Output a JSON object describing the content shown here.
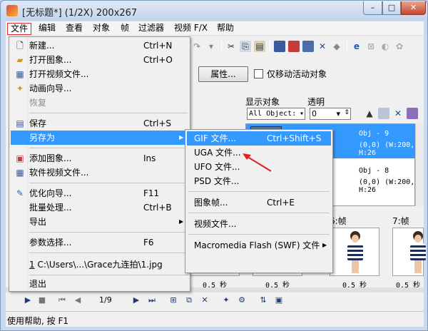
{
  "window": {
    "title": "[无标题*] (1/2X)  200x267",
    "minimize": "–",
    "maximize": "□",
    "close": "✕"
  },
  "menubar": [
    "文件",
    "编辑",
    "查看",
    "对象",
    "帧",
    "过滤器",
    "视频 F/X",
    "帮助"
  ],
  "properties": {
    "button": "属性...",
    "checkbox_label": "仅移动活动对象"
  },
  "object_panel": {
    "display_label": "显示对象",
    "opacity_label": "透明",
    "display_value": "All Object:",
    "opacity_value": "0",
    "objects": [
      {
        "name": "Obj - 9",
        "info": "(0,0) (W:200, H:26"
      },
      {
        "name": "Obj - 8",
        "info": "(0,0) (W:200, H:26"
      }
    ]
  },
  "frames": {
    "labels": [
      "6:帧",
      "7:帧"
    ],
    "times": [
      "0.5 秒",
      "0.5 秒",
      "0.5 秒",
      "0.5 秒"
    ]
  },
  "playbar": {
    "counter": "1/9"
  },
  "status": "使用帮助, 按 F1",
  "file_menu": {
    "new": {
      "label": "新建...",
      "shortcut": "Ctrl+N"
    },
    "open_image": {
      "label": "打开图象...",
      "shortcut": "Ctrl+O"
    },
    "open_video": {
      "label": "打开视频文件..."
    },
    "animation_wizard": {
      "label": "动画向导..."
    },
    "restore": {
      "label": "恢复"
    },
    "save": {
      "label": "保存",
      "shortcut": "Ctrl+S"
    },
    "save_as": {
      "label": "另存为"
    },
    "add_image": {
      "label": "添加图象...",
      "shortcut": "Ins"
    },
    "software_video": {
      "label": "软件视频文件..."
    },
    "optimize_wizard": {
      "label": "优化向导...",
      "shortcut": "F11"
    },
    "batch": {
      "label": "批量处理...",
      "shortcut": "Ctrl+B"
    },
    "export": {
      "label": "导出"
    },
    "preferences": {
      "label": "参数选择...",
      "shortcut": "F6"
    },
    "recent": {
      "number": "1",
      "label": "C:\\Users\\...\\Grace九连拍\\1.jpg"
    },
    "exit": {
      "label": "退出"
    }
  },
  "save_as_menu": {
    "gif": {
      "label": "GIF 文件...",
      "shortcut": "Ctrl+Shift+S"
    },
    "uga": {
      "label": "UGA 文件..."
    },
    "ufo": {
      "label": "UFO 文件..."
    },
    "psd": {
      "label": "PSD 文件..."
    },
    "frame_image": {
      "label": "图象帧...",
      "shortcut": "Ctrl+E"
    },
    "video": {
      "label": "视频文件..."
    },
    "flash": {
      "label": "Macromedia Flash (SWF) 文件"
    }
  },
  "colors": {
    "highlight": "#3399ff",
    "annotation": "#e02020"
  }
}
